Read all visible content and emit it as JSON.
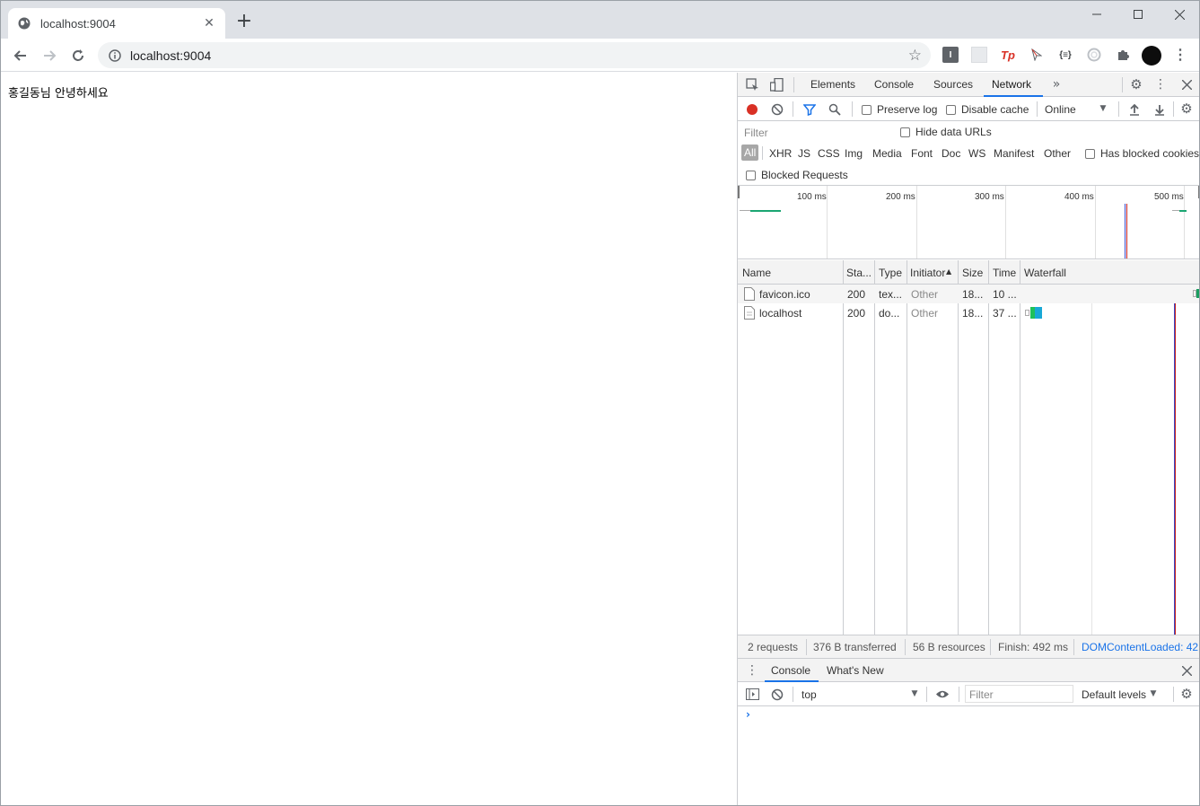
{
  "browser": {
    "tab_title": "localhost:9004",
    "url": "localhost:9004"
  },
  "page": {
    "greeting": "홍길동님 안녕하세요"
  },
  "devtools": {
    "tabs": [
      "Elements",
      "Console",
      "Sources",
      "Network"
    ],
    "active_tab": "Network",
    "network_toolbar": {
      "preserve_log": "Preserve log",
      "disable_cache": "Disable cache",
      "throttle": "Online"
    },
    "filter": {
      "placeholder": "Filter",
      "hide_data_urls": "Hide data URLs",
      "types": [
        "All",
        "XHR",
        "JS",
        "CSS",
        "Img",
        "Media",
        "Font",
        "Doc",
        "WS",
        "Manifest",
        "Other"
      ],
      "has_blocked_cookies": "Has blocked cookies",
      "blocked_requests": "Blocked Requests"
    },
    "overview_ticks": [
      "100 ms",
      "200 ms",
      "300 ms",
      "400 ms",
      "500 ms"
    ],
    "columns": [
      "Name",
      "Sta...",
      "Type",
      "Initiator",
      "Size",
      "Time",
      "Waterfall"
    ],
    "rows": [
      {
        "name": "favicon.ico",
        "status": "200",
        "type": "tex...",
        "initiator": "Other",
        "size": "18...",
        "time": "10 ..."
      },
      {
        "name": "localhost",
        "status": "200",
        "type": "do...",
        "initiator": "Other",
        "size": "18...",
        "time": "37 ..."
      }
    ],
    "summary": {
      "requests": "2 requests",
      "transferred": "376 B transferred",
      "resources": "56 B resources",
      "finish": "Finish: 492 ms",
      "dom_content_loaded": "DOMContentLoaded: 42"
    },
    "drawer": {
      "tabs": [
        "Console",
        "What's New"
      ],
      "context": "top",
      "filter_placeholder": "Filter",
      "levels": "Default levels"
    }
  }
}
